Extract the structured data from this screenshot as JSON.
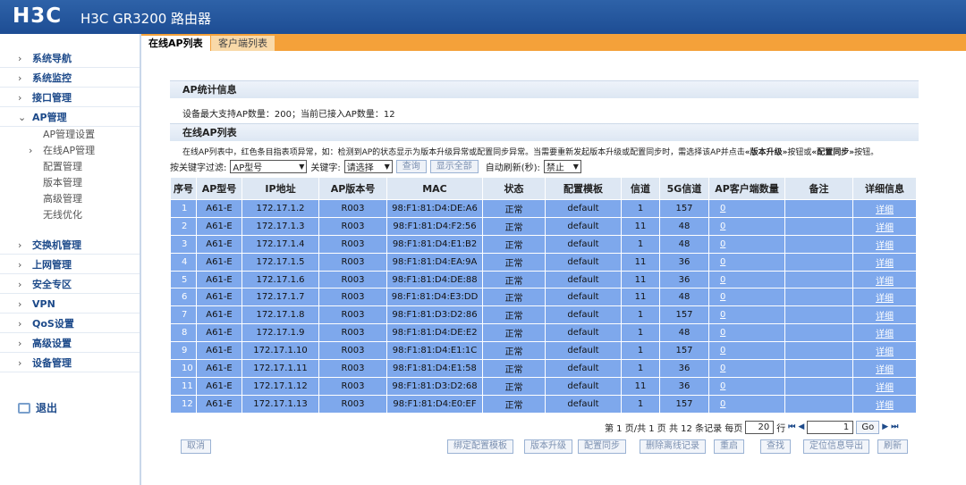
{
  "header": {
    "logo": "H3C",
    "product": "H3C GR3200 路由器"
  },
  "tabs": [
    {
      "label": "在线AP列表"
    },
    {
      "label": "客户端列表"
    }
  ],
  "sidebar": {
    "items": [
      {
        "label": "系统导航"
      },
      {
        "label": "系统监控"
      },
      {
        "label": "接口管理"
      },
      {
        "label": "AP管理"
      },
      {
        "label": "交换机管理"
      },
      {
        "label": "上网管理"
      },
      {
        "label": "安全专区"
      },
      {
        "label": "VPN"
      },
      {
        "label": "QoS设置"
      },
      {
        "label": "高级设置"
      },
      {
        "label": "设备管理"
      }
    ],
    "ap_subitems": [
      {
        "label": "AP管理设置"
      },
      {
        "label": "在线AP管理"
      },
      {
        "label": "配置管理"
      },
      {
        "label": "版本管理"
      },
      {
        "label": "高级管理"
      },
      {
        "label": "无线优化"
      }
    ],
    "logout": "退出"
  },
  "stats": {
    "title": "AP统计信息",
    "info": "设备最大支持AP数量：200；当前已接入AP数量：12"
  },
  "list": {
    "title": "在线AP列表",
    "notice_prefix": "在线AP列表中，红色条目指表项异常，如：检测到AP的状态显示为版本升级异常或配置同步异常。当需要重新发起版本升级或配置同步时，需选择该AP并点击",
    "notice_b1": "«版本升级»",
    "notice_mid": "按钮或",
    "notice_b2": "«配置同步»",
    "notice_suffix": "按钮。"
  },
  "filter": {
    "label": "按关键字过滤:",
    "field": "AP型号",
    "keyword_label": "关键字:",
    "keyword": "请选择",
    "query": "查询",
    "show_all": "显示全部",
    "refresh_label": "自动刷新(秒):",
    "refresh": "禁止"
  },
  "table": {
    "headers": [
      "序号",
      "AP型号",
      "IP地址",
      "AP版本号",
      "MAC",
      "状态",
      "配置模板",
      "信道",
      "5G信道",
      "AP客户端数量",
      "备注",
      "详细信息"
    ],
    "rows": [
      [
        "1",
        "A61-E",
        "172.17.1.2",
        "R003",
        "98:F1:81:D4:DE:A6",
        "正常",
        "default",
        "1",
        "157",
        "0",
        "",
        "详细"
      ],
      [
        "2",
        "A61-E",
        "172.17.1.3",
        "R003",
        "98:F1:81:D4:F2:56",
        "正常",
        "default",
        "11",
        "48",
        "0",
        "",
        "详细"
      ],
      [
        "3",
        "A61-E",
        "172.17.1.4",
        "R003",
        "98:F1:81:D4:E1:B2",
        "正常",
        "default",
        "1",
        "48",
        "0",
        "",
        "详细"
      ],
      [
        "4",
        "A61-E",
        "172.17.1.5",
        "R003",
        "98:F1:81:D4:EA:9A",
        "正常",
        "default",
        "11",
        "36",
        "0",
        "",
        "详细"
      ],
      [
        "5",
        "A61-E",
        "172.17.1.6",
        "R003",
        "98:F1:81:D4:DE:88",
        "正常",
        "default",
        "11",
        "36",
        "0",
        "",
        "详细"
      ],
      [
        "6",
        "A61-E",
        "172.17.1.7",
        "R003",
        "98:F1:81:D4:E3:DD",
        "正常",
        "default",
        "11",
        "48",
        "0",
        "",
        "详细"
      ],
      [
        "7",
        "A61-E",
        "172.17.1.8",
        "R003",
        "98:F1:81:D3:D2:86",
        "正常",
        "default",
        "1",
        "157",
        "0",
        "",
        "详细"
      ],
      [
        "8",
        "A61-E",
        "172.17.1.9",
        "R003",
        "98:F1:81:D4:DE:E2",
        "正常",
        "default",
        "1",
        "48",
        "0",
        "",
        "详细"
      ],
      [
        "9",
        "A61-E",
        "172.17.1.10",
        "R003",
        "98:F1:81:D4:E1:1C",
        "正常",
        "default",
        "1",
        "157",
        "0",
        "",
        "详细"
      ],
      [
        "10",
        "A61-E",
        "172.17.1.11",
        "R003",
        "98:F1:81:D4:E1:58",
        "正常",
        "default",
        "1",
        "36",
        "0",
        "",
        "详细"
      ],
      [
        "11",
        "A61-E",
        "172.17.1.12",
        "R003",
        "98:F1:81:D3:D2:68",
        "正常",
        "default",
        "11",
        "36",
        "0",
        "",
        "详细"
      ],
      [
        "12",
        "A61-E",
        "172.17.1.13",
        "R003",
        "98:F1:81:D4:E0:EF",
        "正常",
        "default",
        "1",
        "157",
        "0",
        "",
        "详细"
      ]
    ]
  },
  "pager": {
    "summary": "第 1 页/共 1 页 共 12 条记录 每页",
    "per_page": "20",
    "rows_label": "行",
    "page": "1",
    "go": "Go"
  },
  "actions": {
    "cancel": "取消",
    "bind_template": "绑定配置模板",
    "upgrade": "版本升级",
    "sync": "配置同步",
    "delete_offline": "删除离线记录",
    "reboot": "重启",
    "find": "查找",
    "export_location": "定位信息导出",
    "refresh": "刷新"
  },
  "colors": {
    "header": "#1d4d94",
    "tabbar": "#f4a13a",
    "row": "#7ea8ec"
  }
}
